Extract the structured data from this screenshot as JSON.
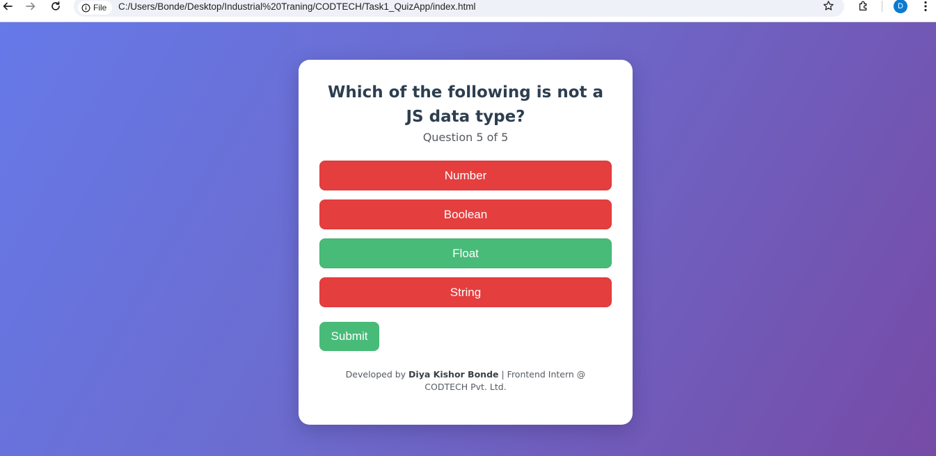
{
  "browser": {
    "site_chip_label": "File",
    "url": "C:/Users/Bonde/Desktop/Industrial%20Traning/CODTECH/Task1_QuizApp/index.html",
    "profile_initial": "D"
  },
  "quiz": {
    "question": "Which of the following is not a JS data type?",
    "counter": "Question 5 of 5",
    "options": [
      {
        "label": "Number",
        "state": "wrong"
      },
      {
        "label": "Boolean",
        "state": "wrong"
      },
      {
        "label": "Float",
        "state": "correct"
      },
      {
        "label": "String",
        "state": "wrong"
      }
    ],
    "submit_label": "Submit"
  },
  "footer": {
    "prefix": "Developed by ",
    "author": "Diya Kishor Bonde",
    "suffix": " | Frontend Intern @ CODTECH Pvt. Ltd."
  },
  "colors": {
    "wrong": "#e53e3e",
    "correct": "#48bb78",
    "question_text": "#2c3e50",
    "gradient_start": "#6679e8",
    "gradient_end": "#764ba6"
  }
}
